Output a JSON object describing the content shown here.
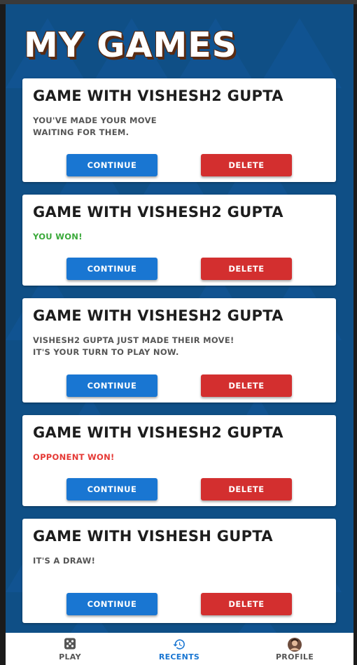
{
  "page": {
    "title": "MY GAMES"
  },
  "colors": {
    "background": "#0f4f86",
    "continue": "#1976d2",
    "delete": "#d32f2f",
    "win": "#3aa93a",
    "loss": "#e53935",
    "nav_active": "#1976d2",
    "nav_inactive": "#555555"
  },
  "games": [
    {
      "title": "GAME WITH VISHESH2 GUPTA",
      "message_lines": [
        "YOU'VE MADE YOUR MOVE",
        "WAITING FOR THEM."
      ],
      "status": "waiting",
      "continue_label": "CONTINUE",
      "delete_label": "DELETE"
    },
    {
      "title": "GAME WITH VISHESH2 GUPTA",
      "message_lines": [
        "YOU WON!"
      ],
      "status": "won",
      "continue_label": "CONTINUE",
      "delete_label": "DELETE"
    },
    {
      "title": "GAME WITH VISHESH2 GUPTA",
      "message_lines": [
        "VISHESH2 GUPTA JUST MADE THEIR MOVE!",
        "IT'S YOUR TURN TO PLAY NOW."
      ],
      "status": "your-turn",
      "continue_label": "CONTINUE",
      "delete_label": "DELETE"
    },
    {
      "title": "GAME WITH VISHESH2 GUPTA",
      "message_lines": [
        "OPPONENT WON!"
      ],
      "status": "lost",
      "continue_label": "CONTINUE",
      "delete_label": "DELETE"
    },
    {
      "title": "GAME WITH VISHESH GUPTA",
      "message_lines": [
        "IT'S A DRAW!"
      ],
      "status": "draw",
      "continue_label": "CONTINUE",
      "delete_label": "DELETE"
    }
  ],
  "nav": {
    "items": [
      {
        "label": "PLAY",
        "icon": "dice-icon",
        "active": false
      },
      {
        "label": "RECENTS",
        "icon": "history-icon",
        "active": true
      },
      {
        "label": "PROFILE",
        "icon": "avatar",
        "active": false
      }
    ]
  }
}
